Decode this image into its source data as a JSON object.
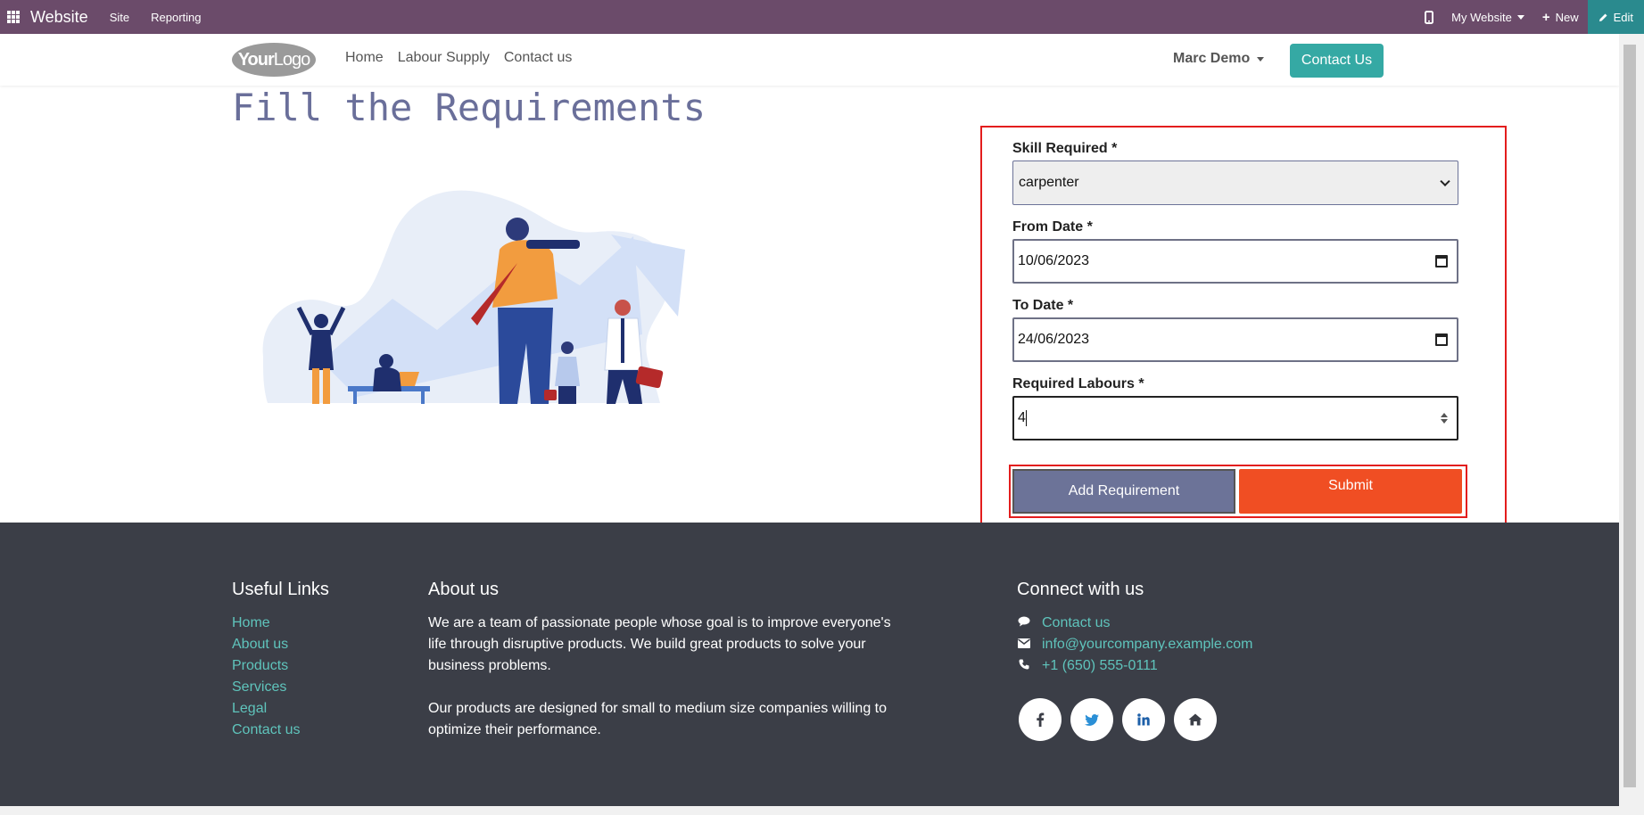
{
  "topbar": {
    "brand": "Website",
    "menu": [
      "Site",
      "Reporting"
    ],
    "website_label": "My Website",
    "new_label": "New",
    "edit_label": "Edit"
  },
  "header": {
    "logo_bold": "Your",
    "logo_light": "Logo",
    "nav": [
      "Home",
      "Labour Supply",
      "Contact us"
    ],
    "user": "Marc Demo",
    "cta": "Contact Us"
  },
  "main": {
    "title": "Fill the Requirements"
  },
  "form": {
    "skill_label": "Skill Required *",
    "skill_value": "carpenter",
    "from_label": "From Date *",
    "from_value": "10/06/2023",
    "to_label": "To Date *",
    "to_value": "24/06/2023",
    "labours_label": "Required Labours *",
    "labours_value": "4",
    "add_button": "Add Requirement",
    "submit_button": "Submit"
  },
  "footer": {
    "links_title": "Useful Links",
    "links": [
      "Home",
      "About us",
      "Products",
      "Services",
      "Legal",
      "Contact us"
    ],
    "about_title": "About us",
    "about_p1": "We are a team of passionate people whose goal is to improve everyone's life through disruptive products. We build great products to solve your business problems.",
    "about_p2": "Our products are designed for small to medium size companies willing to optimize their performance.",
    "connect_title": "Connect with us",
    "contact_link": "Contact us",
    "email": "info@yourcompany.example.com",
    "phone": "+1 (650) 555-0111",
    "socials": [
      "facebook-icon",
      "twitter-icon",
      "linkedin-icon",
      "home-icon"
    ]
  },
  "colors": {
    "topbar": "#6b4b6a",
    "accent": "#35a9a4",
    "submit": "#f04e23",
    "add": "#6c7398",
    "footer": "#3b3e47",
    "highlight": "#e31d1d"
  }
}
